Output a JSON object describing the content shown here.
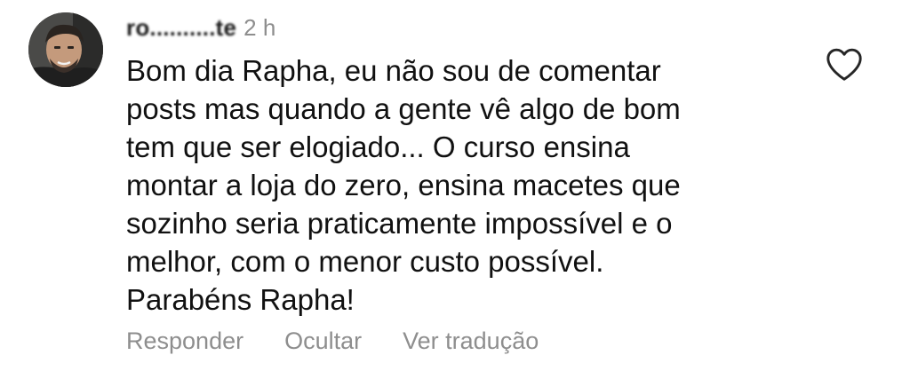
{
  "comment": {
    "username": "ro..........te",
    "timestamp": "2 h",
    "text": "Bom dia Rapha, eu não sou de comentar\nposts mas quando a gente vê algo de bom\ntem que ser elogiado... O curso ensina\nmontar a loja do zero, ensina macetes que\nsozinho seria praticamente impossível e o\nmelhor, com o menor custo possível.\nParabéns Rapha!",
    "like_icon": "heart-outline-icon",
    "avatar": "user-avatar-photo"
  },
  "actions": {
    "reply_label": "Responder",
    "hide_label": "Ocultar",
    "translate_label": "Ver tradução"
  },
  "colors": {
    "primary_text": "#111111",
    "secondary_text": "#8e8e8e",
    "background": "#ffffff"
  }
}
